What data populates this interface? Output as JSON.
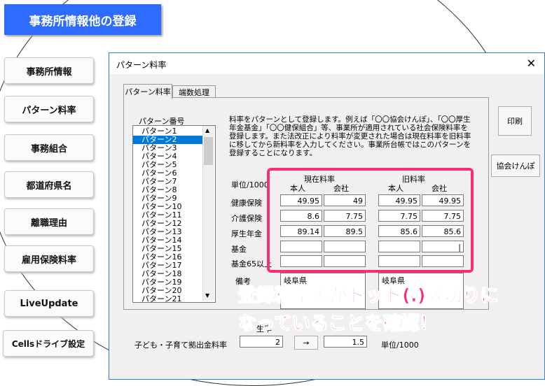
{
  "header": {
    "title": "事務所情報他の登録"
  },
  "menu": [
    "事務所情報",
    "パターン料率",
    "事務組合",
    "都道府県名",
    "離職理由",
    "雇用保険料率",
    "LiveUpdate",
    "Cellsドライブ設定"
  ],
  "dialog": {
    "title": "パターン料率",
    "close_glyph": "✕",
    "tabs": [
      "パターン料率",
      "端数処理"
    ],
    "list_label": "パターン番号",
    "patterns": [
      "パターン1",
      "パターン2",
      "パターン3",
      "パターン4",
      "パターン5",
      "パターン6",
      "パターン7",
      "パターン8",
      "パターン9",
      "パターン10",
      "パターン11",
      "パターン12",
      "パターン13",
      "パターン14",
      "パターン15",
      "パターン16",
      "パターン17",
      "パターン18",
      "パターン19",
      "パターン20",
      "パターン21"
    ],
    "selected_index": 1,
    "description": "料率をパターンとして登録します。例えば「〇〇協会けんぽ」、「〇〇厚生年金基金」「〇〇健保組合」等、事業所が適用されている社会保険料率を登録します。また法改正により料率が変更された場合は現在料率を旧料率に移してから新料率を入力してください。事業所台帳ではこのパターンを登録することになります。",
    "print_button": "印刷",
    "kyokai_button": "協会けんぽ",
    "unit_label": "単位/1000",
    "current_rate_header": "現在料率",
    "old_rate_header": "旧料率",
    "sub_headers": [
      "本人",
      "会社",
      "本人",
      "会社"
    ],
    "rows": [
      {
        "label": "健康保険",
        "values": [
          "49.95",
          "49",
          "49.95",
          "49.95"
        ]
      },
      {
        "label": "介護保険",
        "values": [
          "8.6",
          "7.75",
          "7.75",
          "7.75"
        ]
      },
      {
        "label": "厚生年金",
        "values": [
          "89.14",
          "89.5",
          "85.6",
          "85.6"
        ]
      },
      {
        "label": "基金",
        "values": [
          "",
          "",
          "",
          "|"
        ]
      },
      {
        "label": "基金65以上",
        "values": [
          "",
          "",
          "",
          ""
        ]
      }
    ],
    "remarks_label": "備考",
    "remarks_current": "岐阜県",
    "remarks_old": "岐阜県",
    "child_label": "子ども・子育て拠出金料率",
    "child_current": "2",
    "arrow_glyph": "→",
    "child_old": "1.5",
    "child_unit": "単位/1000",
    "partial_label": "生率"
  },
  "annotation": {
    "line1": "登録料率内がドット(.)区切りに",
    "line2": "なっていることを確認！"
  },
  "colors": {
    "header_bg": "#2f6bff",
    "highlight": "#ff2d6e",
    "selection": "#0078d7"
  }
}
